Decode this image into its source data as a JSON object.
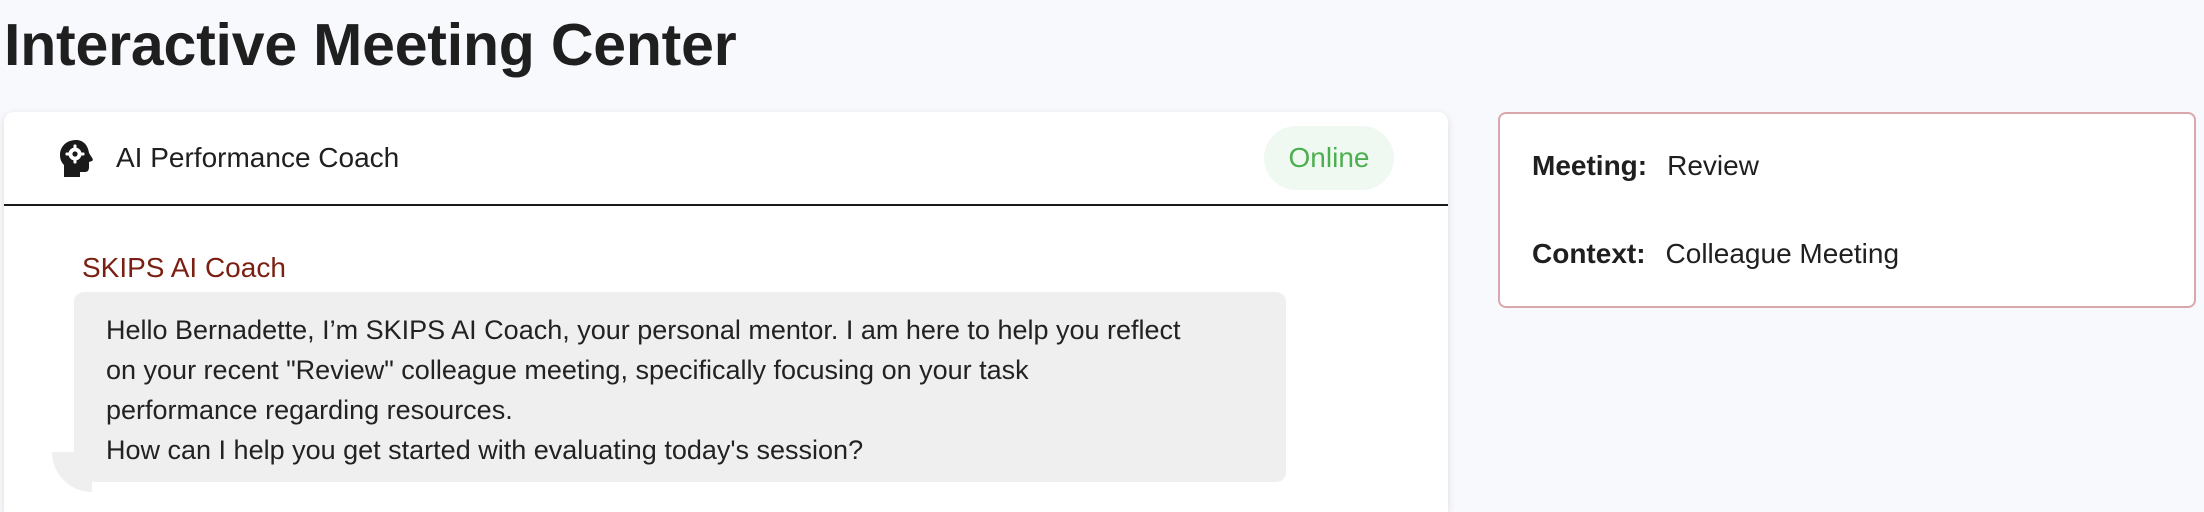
{
  "page": {
    "title": "Interactive Meeting Center"
  },
  "chat": {
    "coach_name": "AI Performance Coach",
    "coach_icon": "head-gear-icon",
    "status": "Online",
    "status_color": "#4caf50",
    "messages": [
      {
        "sender": "SKIPS AI Coach",
        "sender_color": "#7a1f12",
        "lines": [
          "Hello Bernadette, I’m SKIPS AI Coach, your personal mentor. I am here to help you reflect",
          "on your recent \"Review\" colleague meeting, specifically focusing on your task",
          "performance regarding resources.",
          "How can I help you get started with evaluating today's session?"
        ]
      }
    ]
  },
  "info": {
    "meeting_label": "Meeting:",
    "meeting_value": "Review",
    "context_label": "Context:",
    "context_value": "Colleague Meeting",
    "border_color": "#d9a8ad"
  }
}
